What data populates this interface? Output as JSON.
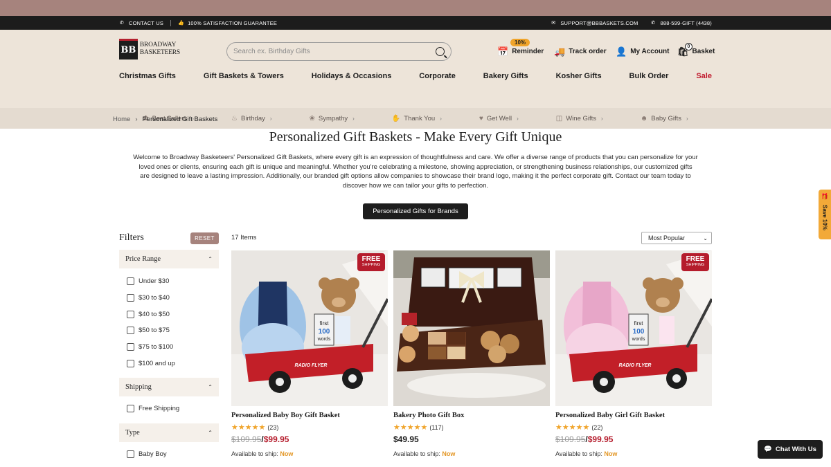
{
  "utility": {
    "contact": "CONTACT US",
    "guarantee": "100% SATISFACTION GUARANTEE",
    "email": "SUPPORT@BBBASKETS.COM",
    "phone": "888-599-GIFT (4438)"
  },
  "header": {
    "logo_line1": "BROADWAY",
    "logo_line2": "BASKETEERS",
    "logo_mark": "BB",
    "search_placeholder": "Search ex. Birthday Gifts",
    "reminder_badge": "10%",
    "reminder": "Reminder",
    "track_order": "Track order",
    "my_account": "My Account",
    "basket": "Basket",
    "basket_count": "0"
  },
  "main_nav": [
    "Christmas Gifts",
    "Gift Baskets & Towers",
    "Holidays & Occasions",
    "Corporate",
    "Bakery Gifts",
    "Kosher Gifts",
    "Bulk Order",
    "Sale"
  ],
  "sub_nav": [
    {
      "label": "Best Sellers",
      "icon": "badge-icon"
    },
    {
      "label": "Birthday",
      "icon": "cake-icon"
    },
    {
      "label": "Sympathy",
      "icon": "flower-icon"
    },
    {
      "label": "Thank You",
      "icon": "hands-icon"
    },
    {
      "label": "Get Well",
      "icon": "heart-hands-icon"
    },
    {
      "label": "Wine Gifts",
      "icon": "wine-glass-icon"
    },
    {
      "label": "Baby Gifts",
      "icon": "baby-icon"
    }
  ],
  "breadcrumb": {
    "home": "Home",
    "current": "Personalized Gift Baskets"
  },
  "page": {
    "title": "Personalized Gift Baskets - Make Every Gift Unique",
    "intro_lines": [
      "Welcome to Broadway Basketeers' Personalized Gift Baskets, where every gift is an expression of thoughtfulness and care. We offer a diverse range of products that you can personalize for your",
      "loved ones or clients, ensuring each gift is unique and meaningful. Whether you're celebrating a milestone, showing appreciation, or strengthening business relationships, our customized gifts",
      "are designed to leave a lasting impression. Additionally, our branded gift options allow companies to showcase their brand logo, making it the perfect corporate gift. Contact our team today to",
      "discover how we can tailor your gifts to perfection."
    ],
    "brand_button": "Personalized Gifts for Brands"
  },
  "filters": {
    "title": "Filters",
    "reset": "RESET",
    "price_range": {
      "title": "Price Range",
      "options": [
        "Under $30",
        "$30 to $40",
        "$40 to $50",
        "$50 to $75",
        "$75 to $100",
        "$100 and up"
      ]
    },
    "shipping": {
      "title": "Shipping",
      "options": [
        "Free Shipping"
      ]
    },
    "type": {
      "title": "Type",
      "options": [
        "Baby Boy"
      ]
    }
  },
  "listing": {
    "count": "17 Items",
    "sort": "Most Popular"
  },
  "products": [
    {
      "name": "Personalized Baby Boy Gift Basket",
      "reviews": "(23)",
      "old_price": "$109.95",
      "price": "$99.95",
      "free_shipping": true,
      "ship_label": "Available to ship:",
      "ship_value": "Now"
    },
    {
      "name": "Bakery Photo Gift Box",
      "reviews": "(117)",
      "old_price": "",
      "price": "$49.95",
      "free_shipping": false,
      "ship_label": "Available to ship:",
      "ship_value": "Now"
    },
    {
      "name": "Personalized Baby Girl Gift Basket",
      "reviews": "(22)",
      "old_price": "$109.95",
      "price": "$99.95",
      "free_shipping": true,
      "ship_label": "Available to ship:",
      "ship_value": "Now"
    }
  ],
  "badges": {
    "free_t1": "FREE",
    "free_t2": "SHIPPING",
    "img1_text": "first 100 words",
    "img3_text": "first 100 words",
    "wagon_text": "RADIO FLYER"
  },
  "side_tab": {
    "label": "Save 10%"
  },
  "chat": {
    "label": "Chat With Us"
  },
  "colors": {
    "accent": "#a6837d",
    "sale": "#c0182c",
    "star": "#f0a42a",
    "header_bg": "#ede4d9"
  }
}
